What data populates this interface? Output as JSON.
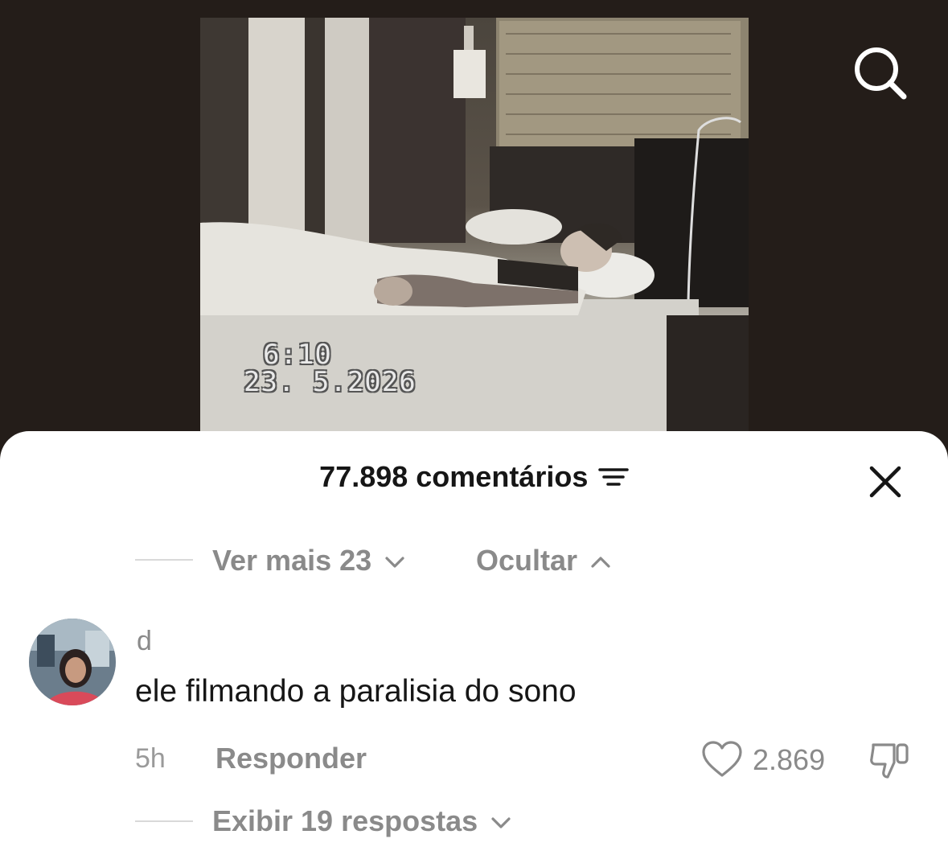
{
  "video": {
    "stamp_time": "6:10",
    "stamp_date": "23. 5.2026",
    "search_icon": "search-icon"
  },
  "comments_sheet": {
    "count_label": "77.898 comentários",
    "filter_icon": "filter-lines-icon",
    "close_icon": "close-icon",
    "replies_controls": {
      "see_more_label": "Ver mais 23",
      "hide_label": "Ocultar"
    },
    "comment": {
      "username": "d",
      "text": "ele filmando a paralisia do sono",
      "age": "5h",
      "reply_label": "Responder",
      "like_count": "2.869",
      "like_icon": "heart-icon",
      "dislike_icon": "thumbs-down-icon",
      "view_replies_label": "Exibir 19 respostas"
    }
  }
}
